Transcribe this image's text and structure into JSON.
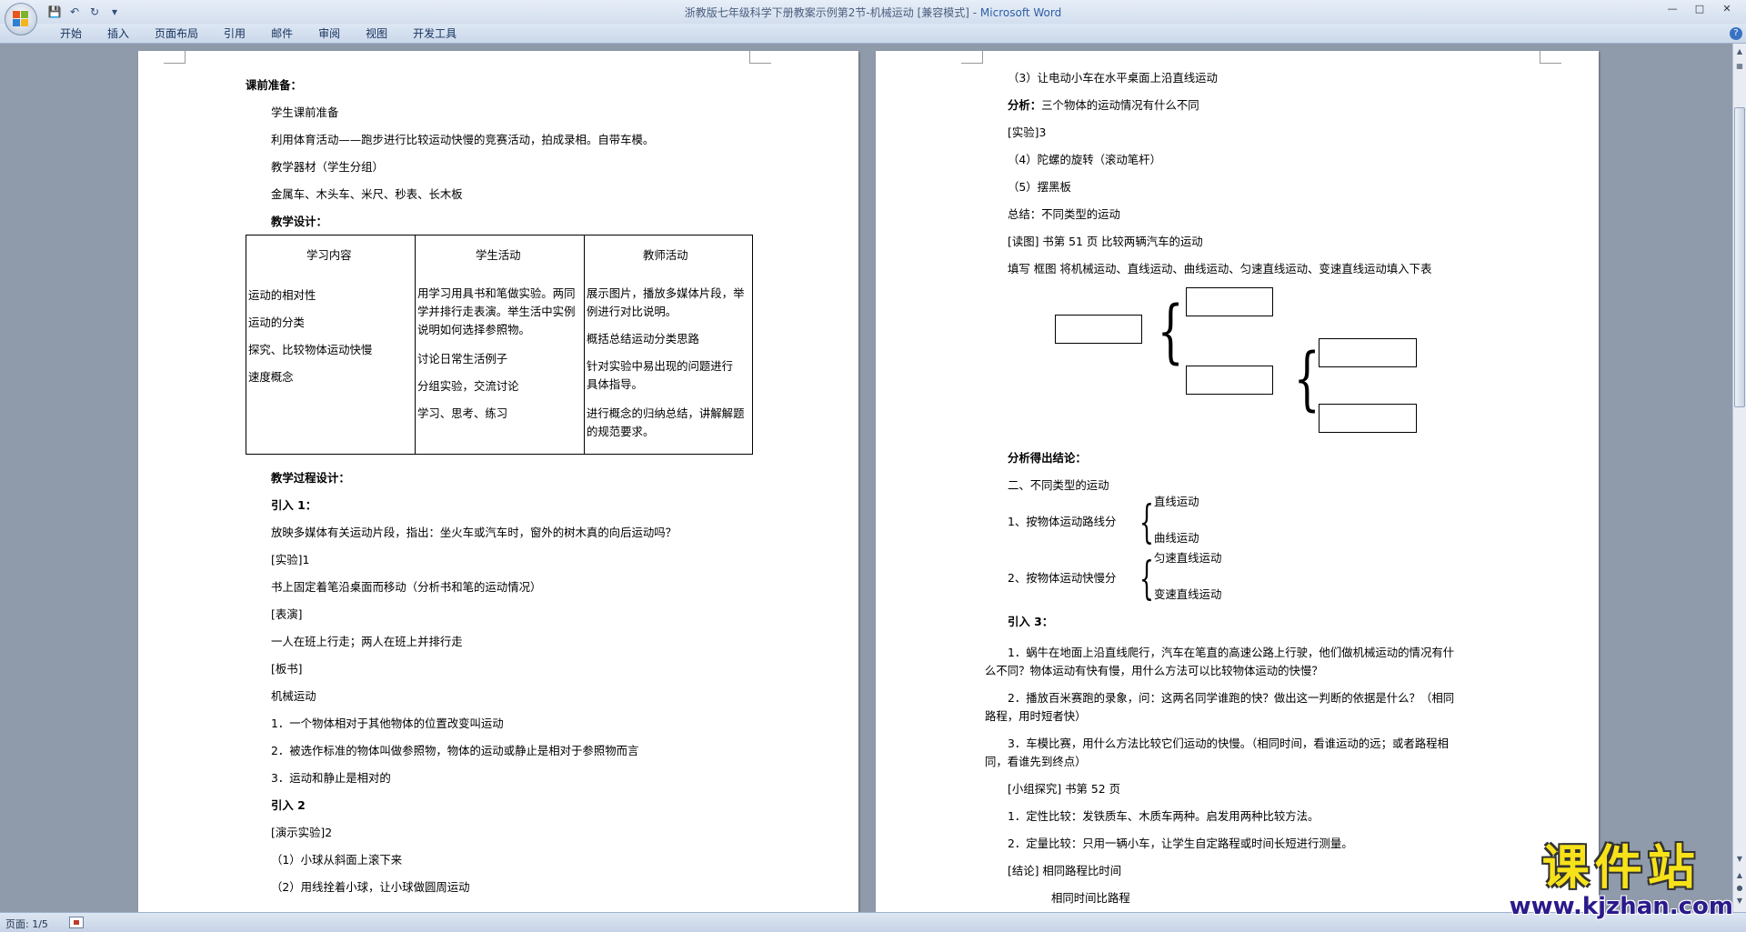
{
  "window": {
    "title": "浙教版七年级科学下册教案示例第2节-机械运动 [兼容模式]",
    "app_name": "Microsoft Word",
    "separator": " - "
  },
  "quick_access": {
    "save_icon": "save-icon",
    "undo_icon": "undo-icon",
    "redo_icon": "redo-icon",
    "more_icon": "customize-icon"
  },
  "ribbon": {
    "tabs": [
      "开始",
      "插入",
      "页面布局",
      "引用",
      "邮件",
      "审阅",
      "视图",
      "开发工具"
    ]
  },
  "left_page": {
    "prep_heading": "课前准备：",
    "prep_lines": [
      "学生课前准备",
      "利用体育活动——跑步进行比较运动快慢的竞赛活动，拍成录相。自带车模。",
      "教学器材（学生分组）",
      "金属车、木头车、米尺、秒表、长木板"
    ],
    "design_heading": "教学设计：",
    "table": {
      "headers": [
        "学习内容",
        "学生活动",
        "教师活动"
      ],
      "col1": [
        "运动的相对性",
        "运动的分类",
        "探究、比较物体运动快慢",
        "速度概念"
      ],
      "col2": [
        "用学习用具书和笔做实验。两同",
        "学并排行走表演。举生活中实例",
        "说明如何选择参照物。",
        "讨论日常生活例子",
        "分组实验，交流讨论",
        "学习、思考、练习"
      ],
      "col3": [
        "展示图片，播放多媒体片段，举",
        "例进行对比说明。",
        "概括总结运动分类思路",
        "针对实验中易出现的问题进行",
        "具体指导。",
        "进行概念的归纳总结，讲解解题",
        "的规范要求。"
      ]
    },
    "process_heading": "教学过程设计：",
    "lines": [
      "引入 1：",
      "放映多媒体有关运动片段，指出：坐火车或汽车时，窗外的树木真的向后运动吗？",
      "[实验]1",
      "书上固定着笔沿桌面而移动（分析书和笔的运动情况）",
      "[表演]",
      "一人在班上行走；两人在班上并排行走",
      "[板书]",
      "机械运动",
      "1．一个物体相对于其他物体的位置改变叫运动",
      "2．被选作标准的物体叫做参照物，物体的运动或静止是相对于参照物而言",
      "3．运动和静止是相对的",
      "引入 2",
      "[演示实验]2",
      "（1）小球从斜面上滚下来",
      "（2）用线拴着小球，让小球做圆周运动"
    ]
  },
  "right_page": {
    "lines_top": [
      "（3）让电动小车在水平桌面上沿直线运动",
      "三个物体的运动情况有什么不同",
      "[实验]3",
      "（4）陀螺的旋转（滚动笔杆）",
      "（5）摆黑板",
      "总结：不同类型的运动",
      "[读图] 书第 51 页  比较两辆汽车的运动",
      "填写  框图  将机械运动、直线运动、曲线运动、匀速直线运动、变速直线运动填入下表"
    ],
    "analysis_label": "分析：",
    "conclusion_heading": "分析得出结论：",
    "section_two": "二、不同类型的运动",
    "class1_label": "1、按物体运动路线分",
    "class1_items": [
      "直线运动",
      "曲线运动"
    ],
    "class2_label": "2、按物体运动快慢分",
    "class2_items": [
      "匀速直线运动",
      "变速直线运动"
    ],
    "intro3": "引入 3：",
    "paragraphs": [
      [
        "1．蜗牛在地面上沿直线爬行，汽车在笔直的高速公路上行驶，他们做机械运动的情况有什",
        "么不同？物体运动有快有慢，用什么方法可以比较物体运动的快慢？"
      ],
      [
        "2．播放百米赛跑的录象，问：这两名同学谁跑的快？做出这一判断的依据是什么？（相同",
        "路程，用时短者快）"
      ],
      [
        "3．车模比赛，用什么方法比较它们运动的快慢。（相同时间，看谁运动的远；或者路程相",
        "同，看谁先到终点）"
      ]
    ],
    "lines_bottom": [
      "[小组探究]  书第 52 页",
      "1．定性比较：发铁质车、木质车两种。启发用两种比较方法。",
      "2．定量比较：只用一辆小车，让学生自定路程或时间长短进行测量。",
      "[结论]  相同路程比时间",
      "相同时间比路程"
    ]
  },
  "status_bar": {
    "page_info": "页面: 1/5"
  },
  "watermark": {
    "text": "课件站",
    "url": "www.kjzhan.com"
  },
  "colors": {
    "app_blue": "#2d5fa6",
    "watermark_yellow": "#f7e21a",
    "watermark_url": "#2b1a8c",
    "workspace": "#8f9aab"
  }
}
